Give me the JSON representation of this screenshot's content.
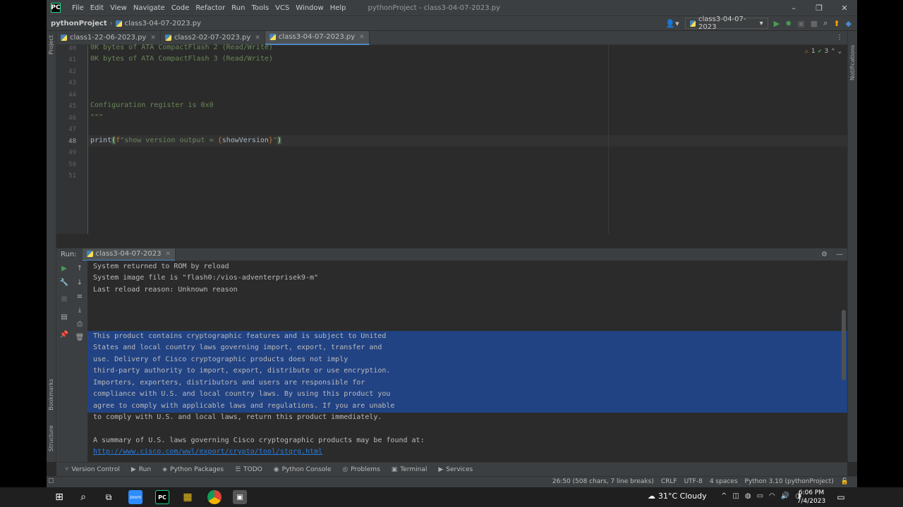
{
  "menu": {
    "items": [
      "File",
      "Edit",
      "View",
      "Navigate",
      "Code",
      "Refactor",
      "Run",
      "Tools",
      "VCS",
      "Window",
      "Help"
    ],
    "window_title": "pythonProject - class3-04-07-2023.py"
  },
  "nav": {
    "project": "pythonProject",
    "file": "class3-04-07-2023.py",
    "run_config": "class3-04-07-2023"
  },
  "tabs": [
    {
      "label": "class1-22-06-2023.py"
    },
    {
      "label": "class2-02-07-2023.py"
    },
    {
      "label": "class3-04-07-2023.py"
    }
  ],
  "side_labels": {
    "project": "Project",
    "notifications": "Notifications",
    "bookmarks": "Bookmarks",
    "structure": "Structure"
  },
  "inspections": {
    "warnings": "1",
    "weak_warnings": "3"
  },
  "editor": {
    "lines": [
      {
        "n": "40",
        "text": "0K bytes of ATA CompactFlash 2 (Read/Write)"
      },
      {
        "n": "41",
        "text": "0K bytes of ATA CompactFlash 3 (Read/Write)"
      },
      {
        "n": "42",
        "text": ""
      },
      {
        "n": "43",
        "text": ""
      },
      {
        "n": "44",
        "text": ""
      },
      {
        "n": "45",
        "text": "Configuration register is 0x0"
      },
      {
        "n": "46",
        "text": "\"\"\""
      },
      {
        "n": "47",
        "text": ""
      },
      {
        "n": "48",
        "text": ""
      },
      {
        "n": "49",
        "text": ""
      },
      {
        "n": "50",
        "text": ""
      },
      {
        "n": "51",
        "text": ""
      }
    ],
    "code48": {
      "fn": "print",
      "open": "(",
      "prefix": "f",
      "str1": "\"show version output = ",
      "lbrace": "{",
      "var": "showVersion",
      "rbrace": "}",
      "str2": "\"",
      "close": ")"
    }
  },
  "run": {
    "label": "Run:",
    "config": "class3-04-07-2023"
  },
  "console": {
    "lines": [
      "System returned to ROM by reload",
      "System image file is \"flash0:/vios-adventerprisek9-m\"",
      "Last reload reason: Unknown reason",
      "",
      "",
      "",
      "This product contains cryptographic features and is subject to United",
      "States and local country laws governing import, export, transfer and",
      "use. Delivery of Cisco cryptographic products does not imply",
      "third-party authority to import, export, distribute or use encryption.",
      "Importers, exporters, distributors and users are responsible for",
      "compliance with U.S. and local country laws. By using this product you",
      "agree to comply with applicable laws and regulations. If you are unable",
      "to comply with U.S. and local laws, return this product immediately.",
      "",
      "A summary of U.S. laws governing Cisco cryptographic products may be found at:"
    ],
    "link": "http://www.cisco.com/wwl/export/crypto/tool/stqrg.html"
  },
  "bottom_tabs": [
    "Version Control",
    "Run",
    "Python Packages",
    "TODO",
    "Python Console",
    "Problems",
    "Terminal",
    "Services"
  ],
  "status": {
    "position": "26:50 (508 chars, 7 line breaks)",
    "line_sep": "CRLF",
    "encoding": "UTF-8",
    "indent": "4 spaces",
    "interpreter": "Python 3.10 (pythonProject)"
  },
  "taskbar": {
    "weather": "31°C  Cloudy",
    "time": "6:06 PM",
    "date": "7/4/2023",
    "zoom_label": "zoom"
  },
  "colors": {
    "accent": "#4a88c7",
    "selection": "#214283",
    "string": "#6a8759",
    "link": "#287bde"
  }
}
